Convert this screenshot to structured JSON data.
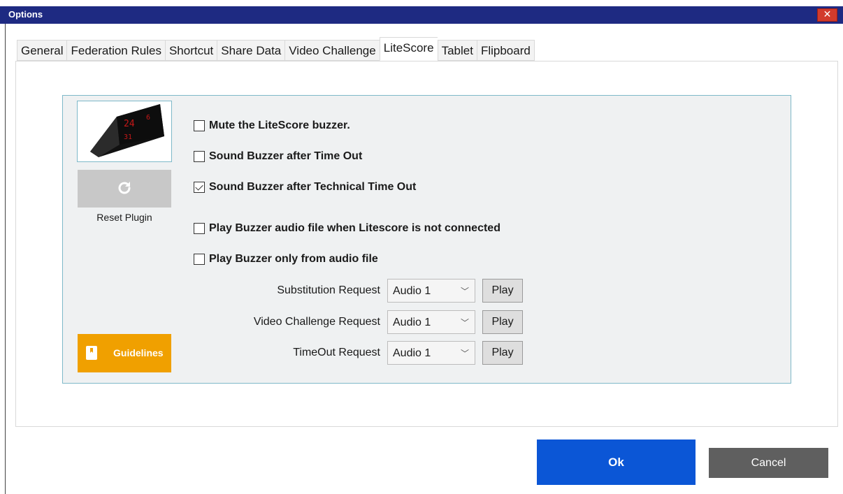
{
  "window": {
    "title": "Options",
    "close_label": "✕"
  },
  "tabs": [
    {
      "label": "General"
    },
    {
      "label": "Federation Rules"
    },
    {
      "label": "Shortcut"
    },
    {
      "label": "Share Data"
    },
    {
      "label": "Video Challenge"
    },
    {
      "label": "LiteScore",
      "active": true
    },
    {
      "label": "Tablet"
    },
    {
      "label": "Flipboard"
    }
  ],
  "left_panel": {
    "device_image_label": "LiteScore device",
    "reset_icon": "refresh-icon",
    "reset_label": "Reset Plugin",
    "guidelines_icon": "book-icon",
    "guidelines_label": "Guidelines"
  },
  "options": [
    {
      "label": "Mute the LiteScore buzzer.",
      "checked": false
    },
    {
      "label": "Sound Buzzer after Time Out",
      "checked": false
    },
    {
      "label": "Sound Buzzer after Technical Time Out",
      "checked": true
    },
    {
      "label": "Play Buzzer audio file when Litescore is not connected",
      "checked": false
    },
    {
      "label": "Play Buzzer only from audio file",
      "checked": false
    }
  ],
  "audio_requests": [
    {
      "label": "Substitution Request",
      "value": "Audio 1",
      "play_label": "Play"
    },
    {
      "label": "Video Challenge Request",
      "value": "Audio 1",
      "play_label": "Play"
    },
    {
      "label": "TimeOut Request",
      "value": "Audio 1",
      "play_label": "Play"
    }
  ],
  "footer": {
    "ok_label": "Ok",
    "cancel_label": "Cancel"
  },
  "colors": {
    "titlebar": "#1e2a82",
    "close": "#d23b2c",
    "ok": "#0b56d6",
    "cancel": "#5f5f5f",
    "guidelines": "#f0a000",
    "group_border": "#7eb9c9"
  }
}
